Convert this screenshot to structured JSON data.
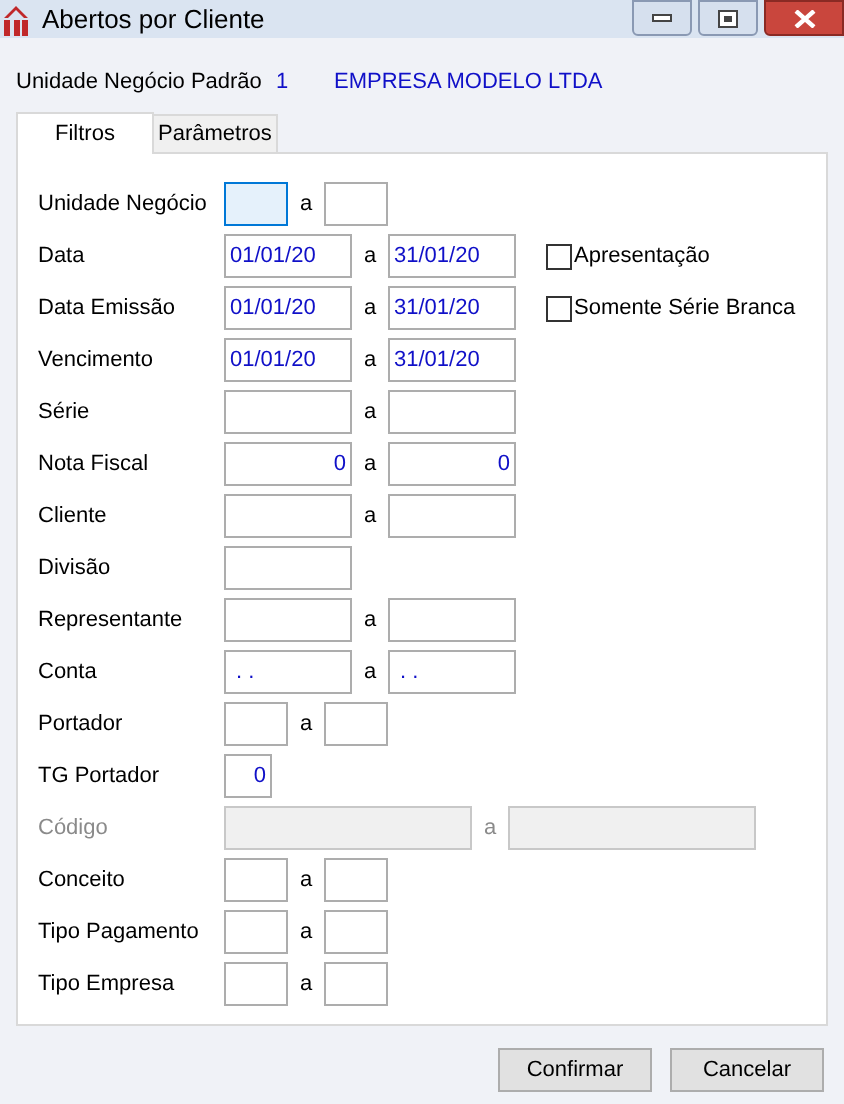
{
  "window": {
    "title": "Abertos por Cliente"
  },
  "header": {
    "label": "Unidade Negócio Padrão",
    "code": "1",
    "name": "EMPRESA MODELO LTDA"
  },
  "tabs": [
    {
      "label": "Filtros",
      "selected": true
    },
    {
      "label": "Parâmetros",
      "selected": false
    }
  ],
  "rows": [
    {
      "label": "Unidade Negócio",
      "kind": "short",
      "disabled": false,
      "from": {
        "focused": true
      },
      "separator": "a",
      "to": {
        "focused": false
      }
    },
    {
      "label": "Data",
      "kind": "medium",
      "disabled": false,
      "from": {
        "value": "01/01/20",
        "focused": false
      },
      "separator": "a",
      "to": {
        "value": "31/01/20",
        "focused": false
      },
      "checkbox": {
        "label": "Apresentação",
        "checked": false
      }
    },
    {
      "label": "Data Emissão",
      "kind": "medium",
      "disabled": false,
      "from": {
        "value": "01/01/20",
        "focused": false
      },
      "separator": "a",
      "to": {
        "value": "31/01/20",
        "focused": false
      },
      "checkbox": {
        "label": "Somente Série Branca",
        "checked": false
      }
    },
    {
      "label": "Vencimento",
      "kind": "medium",
      "disabled": false,
      "from": {
        "value": "01/01/20",
        "focused": false
      },
      "separator": "a",
      "to": {
        "value": "31/01/20",
        "focused": false
      }
    },
    {
      "label": "Série",
      "kind": "medium",
      "disabled": false,
      "from": {
        "focused": false
      },
      "separator": "a",
      "to": {
        "focused": false
      }
    },
    {
      "label": "Nota Fiscal",
      "kind": "numeric",
      "disabled": false,
      "from": {
        "value": "0",
        "focused": false
      },
      "separator": "a",
      "to": {
        "value": "0",
        "focused": false
      }
    },
    {
      "label": "Cliente",
      "kind": "medium",
      "disabled": false,
      "from": {
        "focused": false
      },
      "separator": "a",
      "to": {
        "focused": false
      }
    },
    {
      "label": "Divisão",
      "kind": "medium",
      "disabled": false,
      "from": {
        "focused": false
      }
    },
    {
      "label": "Representante",
      "kind": "medium",
      "disabled": false,
      "from": {
        "focused": false
      },
      "separator": "a",
      "to": {
        "focused": false
      }
    },
    {
      "label": "Conta",
      "kind": "medium",
      "disabled": false,
      "from": {
        "value": " . .",
        "focused": false
      },
      "separator": "a",
      "to": {
        "value": " . .",
        "focused": false
      }
    },
    {
      "label": "Portador",
      "kind": "short",
      "disabled": false,
      "from": {
        "focused": false
      },
      "separator": "a",
      "to": {
        "focused": false
      }
    },
    {
      "label": "TG Portador",
      "kind": "tiny",
      "disabled": false,
      "from": {
        "value": "0",
        "focused": false
      }
    },
    {
      "label": "Código",
      "kind": "wide",
      "disabled": true,
      "from": {
        "focused": false
      },
      "separator": "a",
      "to": {
        "focused": false
      }
    },
    {
      "label": "Conceito",
      "kind": "short",
      "disabled": false,
      "from": {
        "focused": false
      },
      "separator": "a",
      "to": {
        "focused": false
      }
    },
    {
      "label": "Tipo Pagamento",
      "kind": "short",
      "disabled": false,
      "from": {
        "focused": false
      },
      "separator": "a",
      "to": {
        "focused": false
      }
    },
    {
      "label": "Tipo Empresa",
      "kind": "short",
      "disabled": false,
      "from": {
        "focused": false
      },
      "separator": "a",
      "to": {
        "focused": false
      }
    }
  ],
  "buttons": [
    "Confirmar",
    "Cancelar"
  ]
}
